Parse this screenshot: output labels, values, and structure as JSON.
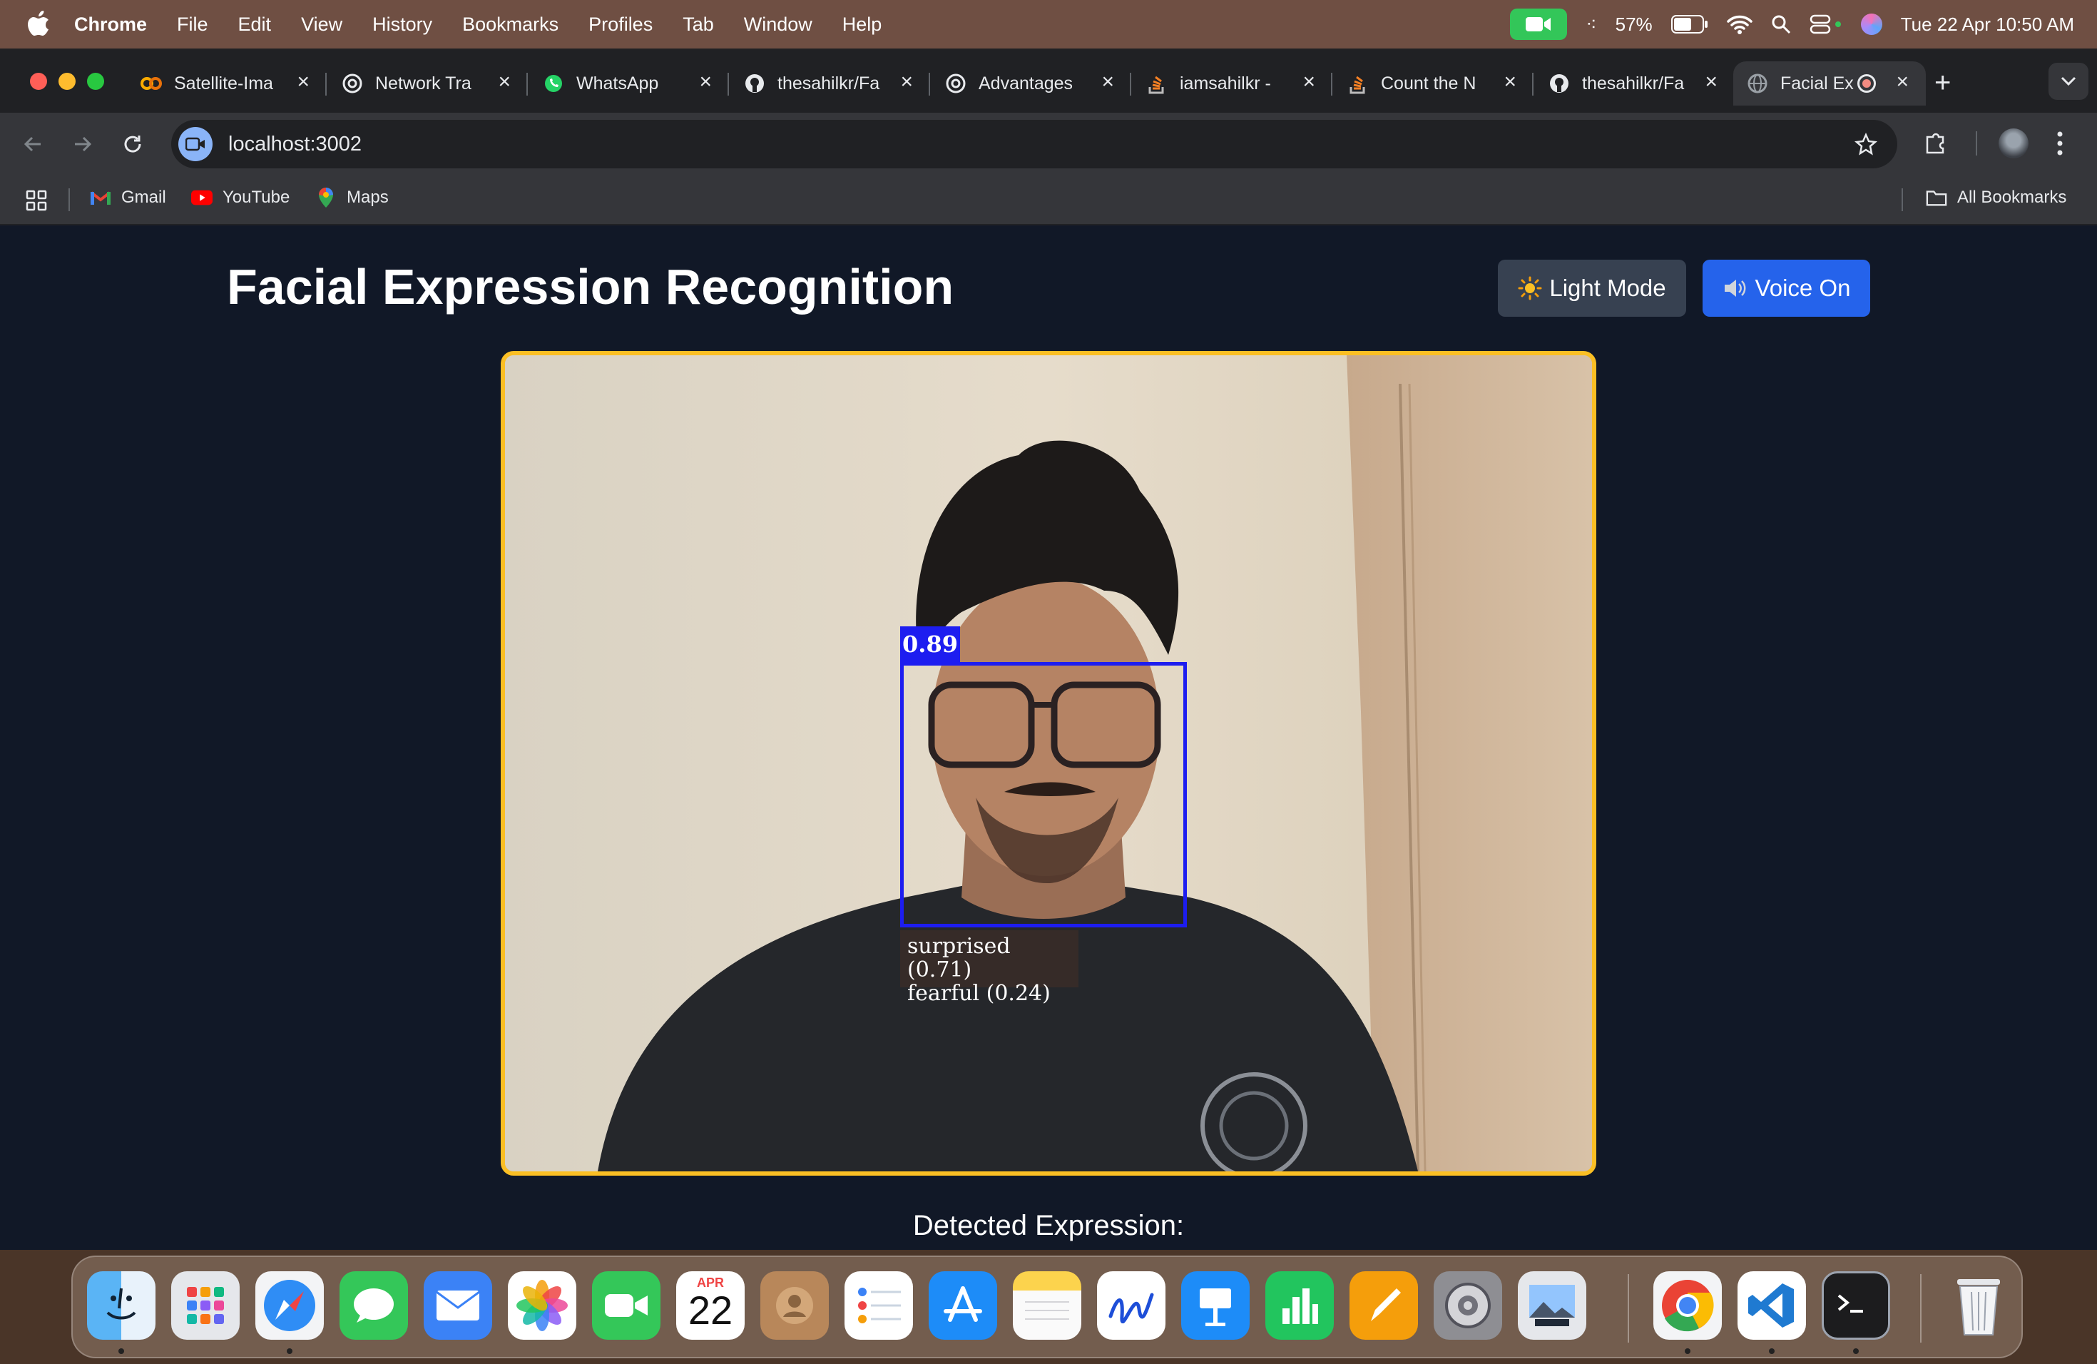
{
  "menubar": {
    "app_name": "Chrome",
    "items": [
      "File",
      "Edit",
      "View",
      "History",
      "Bookmarks",
      "Profiles",
      "Tab",
      "Window",
      "Help"
    ],
    "battery": "57%",
    "datetime": "Tue 22 Apr  10:50 AM"
  },
  "tabs": [
    {
      "title": "Satellite-Ima",
      "icon": "colab-icon"
    },
    {
      "title": "Network Tra",
      "icon": "chatgpt-icon"
    },
    {
      "title": "WhatsApp",
      "icon": "whatsapp-icon"
    },
    {
      "title": "thesahilkr/Fa",
      "icon": "github-icon"
    },
    {
      "title": "Advantages",
      "icon": "chatgpt-icon"
    },
    {
      "title": "iamsahilkr -",
      "icon": "stackoverflow-icon"
    },
    {
      "title": "Count the N",
      "icon": "stackoverflow-icon"
    },
    {
      "title": "thesahilkr/Fa",
      "icon": "github-icon"
    },
    {
      "title": "Facial Ex",
      "icon": "globe-icon",
      "active": true
    }
  ],
  "omnibox": {
    "url": "localhost:3002"
  },
  "bookmarks": {
    "items": [
      {
        "label": "Gmail",
        "icon": "gmail-icon"
      },
      {
        "label": "YouTube",
        "icon": "youtube-icon"
      },
      {
        "label": "Maps",
        "icon": "maps-icon"
      }
    ],
    "all_label": "All Bookmarks"
  },
  "app": {
    "title": "Facial Expression Recognition",
    "light_mode_label": "Light Mode",
    "voice_label": "Voice On",
    "score": "0.89",
    "expressions": [
      "surprised (0.71)",
      "fearful (0.24)"
    ],
    "detected_label": "Detected Expression:"
  },
  "dock": {
    "calendar_month": "APR",
    "calendar_day": "22",
    "apps": [
      "finder",
      "launchpad",
      "safari",
      "messages",
      "mail",
      "photos",
      "facetime",
      "calendar",
      "contacts",
      "reminders",
      "app-store",
      "notes",
      "freeform",
      "keynote",
      "numbers",
      "pages",
      "system-settings",
      "preview",
      "chrome",
      "vscode",
      "terminal",
      "trash"
    ]
  }
}
